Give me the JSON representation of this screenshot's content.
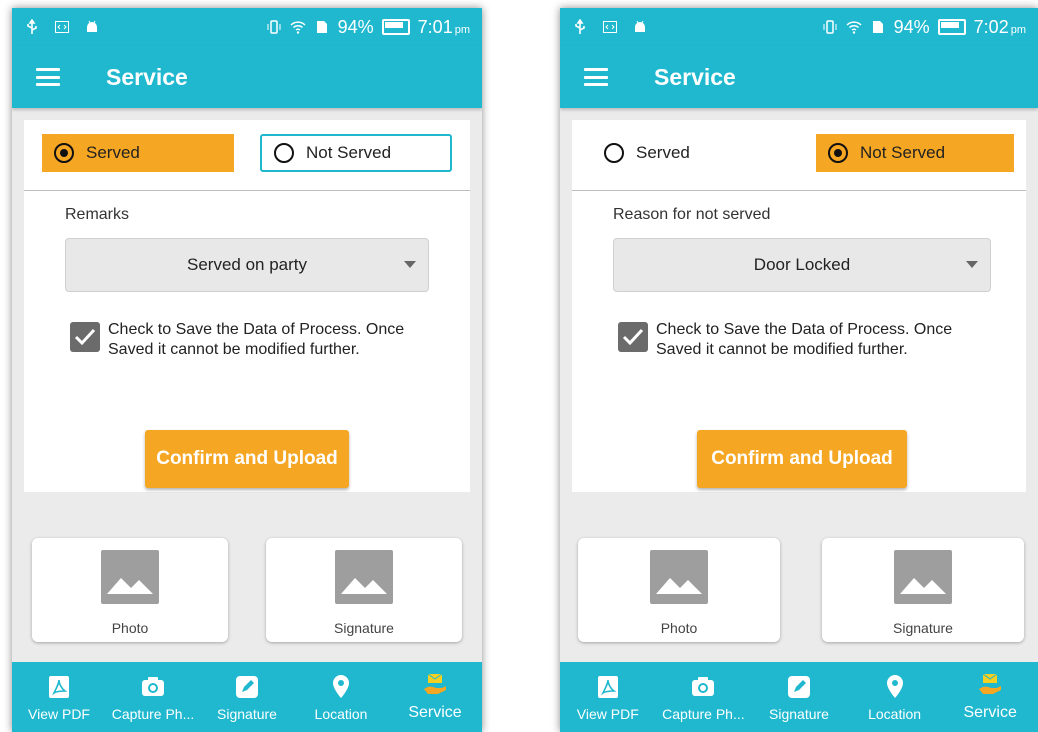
{
  "colors": {
    "primary": "#1fb8cf",
    "accent": "#f5a623",
    "background": "#ebebeb"
  },
  "screens": [
    {
      "status_bar": {
        "battery": "94%",
        "time": "7:01",
        "time_suffix": "pm"
      },
      "app_bar": {
        "title": "Service"
      },
      "radio_options": [
        {
          "label": "Served",
          "selected": true
        },
        {
          "label": "Not Served",
          "selected": false
        }
      ],
      "field_label": "Remarks",
      "dropdown_value": "Served on party",
      "checkbox": {
        "checked": true,
        "text": "Check to Save the Data of Process. Once Saved it cannot be modified further."
      },
      "confirm_button": "Confirm and Upload",
      "tiles": [
        {
          "label": "Photo",
          "icon": "image-placeholder-icon"
        },
        {
          "label": "Signature",
          "icon": "image-placeholder-icon"
        }
      ],
      "bottom_nav": [
        {
          "label": "View PDF",
          "icon": "pdf-icon"
        },
        {
          "label": "Capture Ph...",
          "icon": "camera-icon"
        },
        {
          "label": "Signature",
          "icon": "pencil-icon"
        },
        {
          "label": "Location",
          "icon": "location-pin-icon"
        },
        {
          "label": "Service",
          "icon": "hand-envelope-icon",
          "active": true
        }
      ]
    },
    {
      "status_bar": {
        "battery": "94%",
        "time": "7:02",
        "time_suffix": "pm"
      },
      "app_bar": {
        "title": "Service"
      },
      "radio_options": [
        {
          "label": "Served",
          "selected": false
        },
        {
          "label": "Not Served",
          "selected": true
        }
      ],
      "field_label": "Reason for not served",
      "dropdown_value": "Door Locked",
      "checkbox": {
        "checked": true,
        "text": "Check to Save the Data of Process. Once Saved it cannot be modified further."
      },
      "confirm_button": "Confirm and Upload",
      "tiles": [
        {
          "label": "Photo",
          "icon": "image-placeholder-icon"
        },
        {
          "label": "Signature",
          "icon": "image-placeholder-icon"
        }
      ],
      "bottom_nav": [
        {
          "label": "View PDF",
          "icon": "pdf-icon"
        },
        {
          "label": "Capture Ph...",
          "icon": "camera-icon"
        },
        {
          "label": "Signature",
          "icon": "pencil-icon"
        },
        {
          "label": "Location",
          "icon": "location-pin-icon"
        },
        {
          "label": "Service",
          "icon": "hand-envelope-icon",
          "active": true
        }
      ]
    }
  ]
}
